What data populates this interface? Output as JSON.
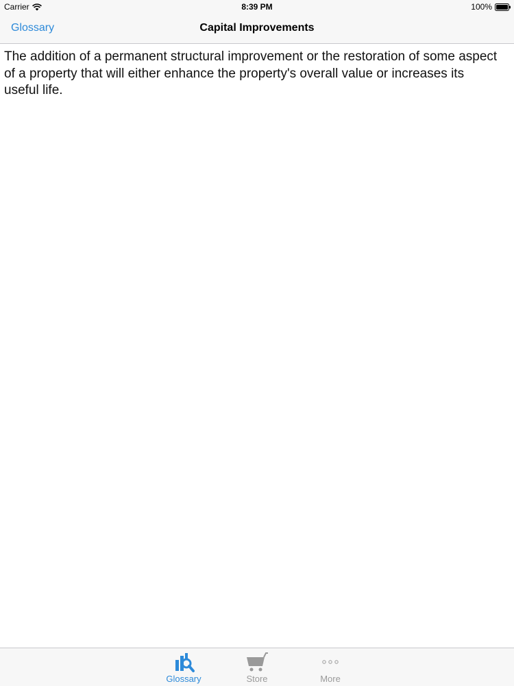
{
  "status_bar": {
    "carrier": "Carrier",
    "time": "8:39 PM",
    "battery": "100%",
    "wifi_icon": "wifi-icon",
    "battery_icon": "battery-icon"
  },
  "nav": {
    "back_label": "Glossary",
    "title": "Capital Improvements"
  },
  "content": {
    "definition": "The addition of a permanent structural improvement or the restoration of some aspect of a property that will either enhance the property's overall value or increases its useful life."
  },
  "tabs": [
    {
      "label": "Glossary",
      "icon": "glossary-chart-search-icon",
      "active": true
    },
    {
      "label": "Store",
      "icon": "shopping-cart-icon",
      "active": false
    },
    {
      "label": "More",
      "icon": "more-dots-icon",
      "active": false
    }
  ],
  "colors": {
    "accent": "#2d8ad9",
    "inactive": "#9a9a9a",
    "bar_background": "#f7f7f7"
  }
}
